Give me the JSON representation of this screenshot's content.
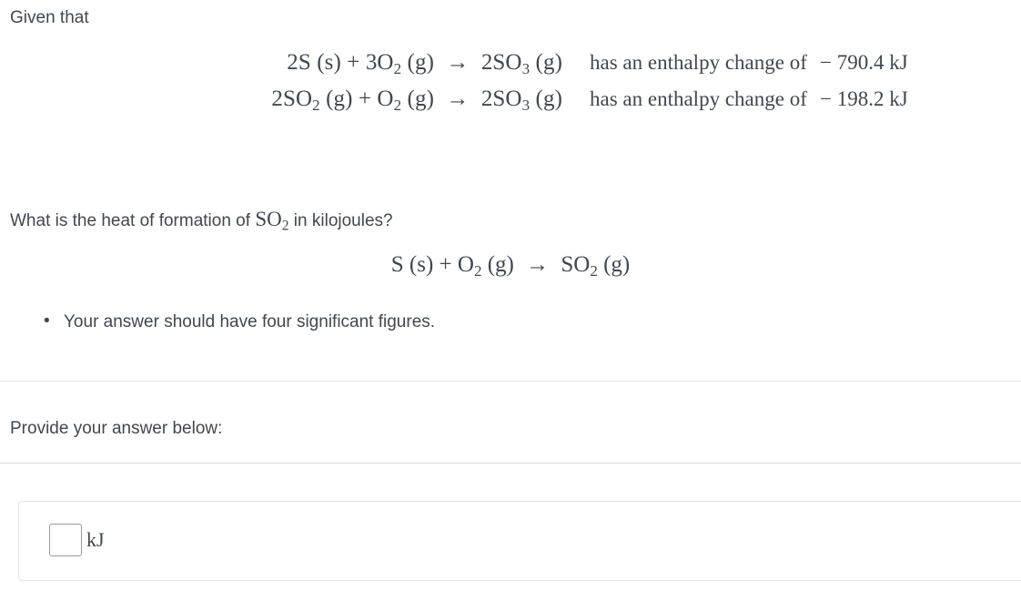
{
  "colors": {
    "text": "#41474f",
    "divider": "#e6e7e9",
    "card_border": "#e4e5e7",
    "input_border": "#9a9a9a",
    "background": "#ffffff"
  },
  "stem": {
    "given_label": "Given that",
    "equations": [
      {
        "lhs_parts": [
          {
            "text": "2S (s)"
          },
          {
            "text": " + "
          },
          {
            "text": "3O"
          },
          {
            "sub": "2"
          },
          {
            "text": " (g)"
          },
          {
            "text": " → "
          },
          {
            "text": "2SO"
          },
          {
            "sub": "3"
          },
          {
            "text": " (g)"
          }
        ],
        "lhs_plain": "2S (s) + 3O2 (g) → 2SO3 (g)",
        "statement": "has an enthalpy change of",
        "value": "− 790.4 kJ",
        "enthalpy_number": -790.4,
        "enthalpy_unit": "kJ"
      },
      {
        "lhs_parts": [
          {
            "text": "2SO"
          },
          {
            "sub": "2"
          },
          {
            "text": " (g)"
          },
          {
            "text": " + "
          },
          {
            "text": "O"
          },
          {
            "sub": "2"
          },
          {
            "text": " (g)"
          },
          {
            "text": " → "
          },
          {
            "text": "2SO"
          },
          {
            "sub": "3"
          },
          {
            "text": " (g)"
          }
        ],
        "lhs_plain": "2SO2 (g) + O2 (g) → 2SO3 (g)",
        "statement": "has an enthalpy change of",
        "value": "− 198.2 kJ",
        "enthalpy_number": -198.2,
        "enthalpy_unit": "kJ"
      }
    ]
  },
  "question": {
    "prefix": "What is the heat of formation of ",
    "formula_base": "SO",
    "formula_sub": "2",
    "suffix": " in kilojoules?",
    "target_equation": "S (s) + O₂ (g) → SO₂ (g)",
    "target_equation_parts": [
      {
        "text": "S (s)"
      },
      {
        "text": " + "
      },
      {
        "text": "O"
      },
      {
        "sub": "2"
      },
      {
        "text": " (g)"
      },
      {
        "text": " → "
      },
      {
        "text": "SO"
      },
      {
        "sub": "2"
      },
      {
        "text": " (g)"
      }
    ]
  },
  "hints": [
    "Your answer should have four significant figures."
  ],
  "answer_section": {
    "prompt": "Provide your answer below:",
    "input_value": "",
    "input_placeholder": "",
    "unit_label": "kJ"
  }
}
